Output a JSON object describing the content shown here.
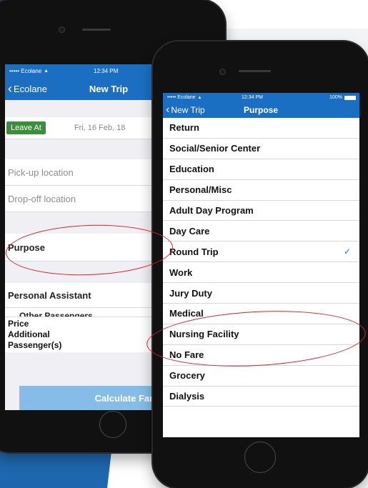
{
  "back_phone": {
    "status": {
      "carrier": "••••• Ecolane",
      "wifi": "▲",
      "time": "12:34 PM"
    },
    "nav": {
      "back_label": "Ecolane",
      "title": "New Trip"
    },
    "leave": {
      "badge": "Leave At",
      "date": "Fri, 16 Feb, 18"
    },
    "fields": {
      "pickup": "Pick-up location",
      "dropoff": "Drop-off location",
      "purpose": "Purpose"
    },
    "personal_assistant": "Personal Assistant",
    "other_passengers": "Other Passengers",
    "price_label": "Price",
    "additional_label": "Additional",
    "passengers_label": "Passenger(s)",
    "calc_button": "Calculate Fare"
  },
  "front_phone": {
    "status": {
      "carrier": "••••• Ecolane",
      "wifi": "▲",
      "time": "12:34 PM",
      "battery": "100%"
    },
    "nav": {
      "back_label": "New Trip",
      "title": "Purpose"
    },
    "items": [
      {
        "label": "Return",
        "checked": false
      },
      {
        "label": "Social/Senior Center",
        "checked": false
      },
      {
        "label": "Education",
        "checked": false
      },
      {
        "label": "Personal/Misc",
        "checked": false
      },
      {
        "label": "Adult Day Program",
        "checked": false
      },
      {
        "label": "Day Care",
        "checked": false
      },
      {
        "label": "Round Trip",
        "checked": true
      },
      {
        "label": "Work",
        "checked": false
      },
      {
        "label": "Jury Duty",
        "checked": false
      },
      {
        "label": "Medical",
        "checked": false
      },
      {
        "label": "Nursing Facility",
        "checked": false
      },
      {
        "label": "No Fare",
        "checked": false
      },
      {
        "label": "Grocery",
        "checked": false
      },
      {
        "label": "Dialysis",
        "checked": false
      }
    ],
    "check_glyph": "✓"
  },
  "colors": {
    "brand_blue": "#1b6fc2",
    "leave_green": "#3c8e3c",
    "annotation_red": "#d0232a",
    "calc_button": "#85bde8"
  }
}
